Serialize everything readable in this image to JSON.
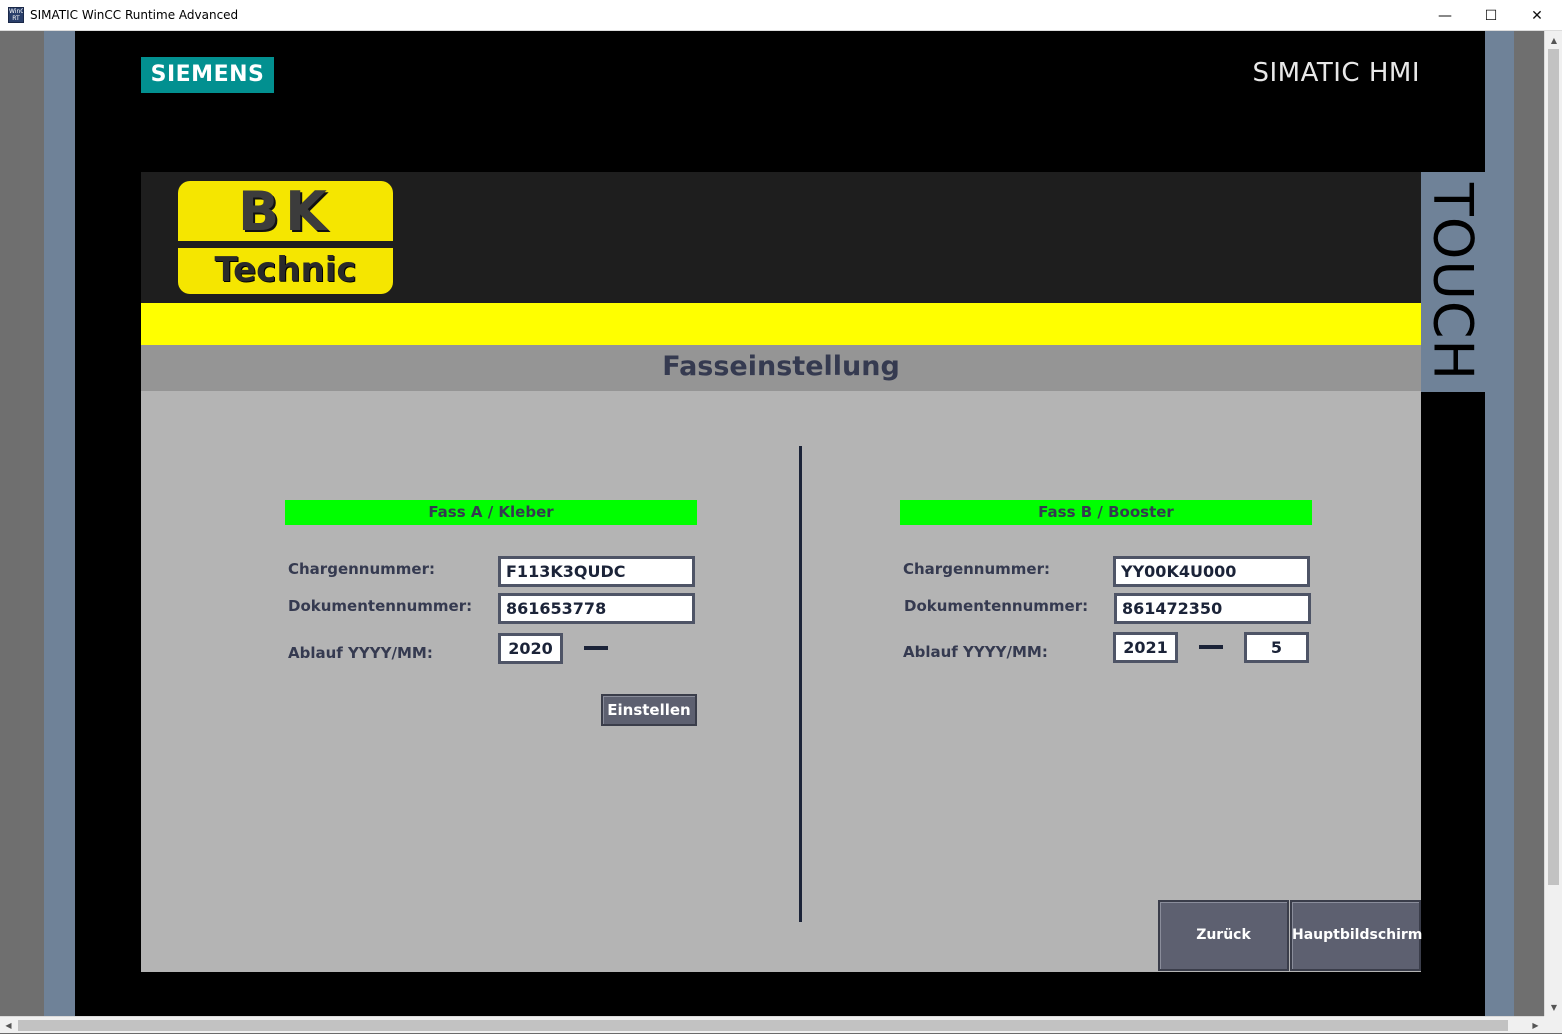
{
  "window": {
    "title": "SIMATIC WinCC Runtime Advanced",
    "icon_text": "WinCC RT",
    "minimize": "—",
    "maximize": "☐",
    "close": "✕"
  },
  "panel": {
    "brand": "SIEMENS",
    "product": "SIMATIC HMI",
    "side_label": "TOUCH"
  },
  "logo": {
    "line1": "BK",
    "line2": "Technic"
  },
  "page": {
    "title": "Fasseinstellung"
  },
  "fass_a": {
    "header": "Fass A / Kleber",
    "charge_label": "Chargennummer:",
    "charge_value": "F113K3QUDC",
    "doc_label": "Dokumentennummer:",
    "doc_value": "861653778",
    "expiry_label": "Ablauf YYYY/MM:",
    "expiry_year": "2020",
    "set_button": "Einstellen"
  },
  "fass_b": {
    "header": "Fass B / Booster",
    "charge_label": "Chargennummer:",
    "charge_value": "YY00K4U000",
    "doc_label": "Dokumentennummer:",
    "doc_value": "861472350",
    "expiry_label": "Ablauf YYYY/MM:",
    "expiry_year": "2021",
    "expiry_month": "5"
  },
  "nav": {
    "back": "Zurück",
    "home": "Hauptbildschirm"
  },
  "colors": {
    "header_green": "#00ff00",
    "yellow_band": "#ffff00",
    "siemens_teal": "#029090",
    "button_gray": "#5d6070"
  },
  "icons": {
    "scroll_up": "▲",
    "scroll_down": "▼",
    "scroll_left": "◀",
    "scroll_right": "▶"
  }
}
